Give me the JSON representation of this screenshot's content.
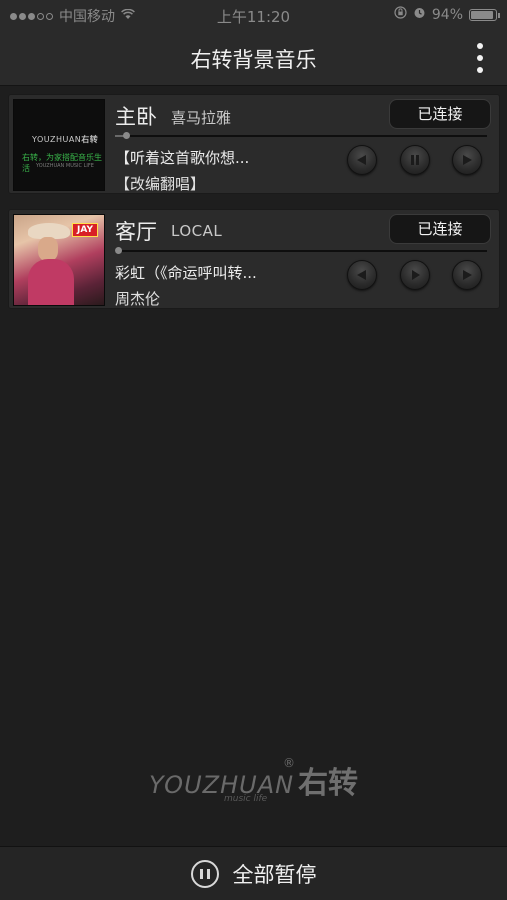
{
  "status_bar": {
    "carrier": "中国移动",
    "time": "上午11:20",
    "battery": "94%",
    "signal_bars": 3,
    "signal_total": 5
  },
  "header": {
    "title": "右转背景音乐"
  },
  "devices": [
    {
      "room": "主卧",
      "source": "喜马拉雅",
      "status": "已连接",
      "song": "【听着这首歌你想...",
      "artist": "【改编翻唱】",
      "progress": 0.03,
      "cover_brand": "YOUZHUAN",
      "cover_brand_cn": "右转",
      "cover_slogan": "右转，为家搭配音乐生活",
      "cover_tiny": "YOUZHUAN MUSIC LIFE"
    },
    {
      "room": "客厅",
      "source": "LOCAL",
      "status": "已连接",
      "song": "彩虹（《命运呼叫转...",
      "artist": "周杰伦",
      "progress": 0.0,
      "cover_tag": "JAY"
    }
  ],
  "logo": {
    "text": "YOUZHUAN",
    "cn": "右转",
    "reg": "®",
    "sub": "music life"
  },
  "footer": {
    "pause_all_label": "全部暂停"
  },
  "colors": {
    "background": "#1e1e1e",
    "bar": "#2a2a2a",
    "card": "#2b2b2b",
    "button": "#161616"
  }
}
